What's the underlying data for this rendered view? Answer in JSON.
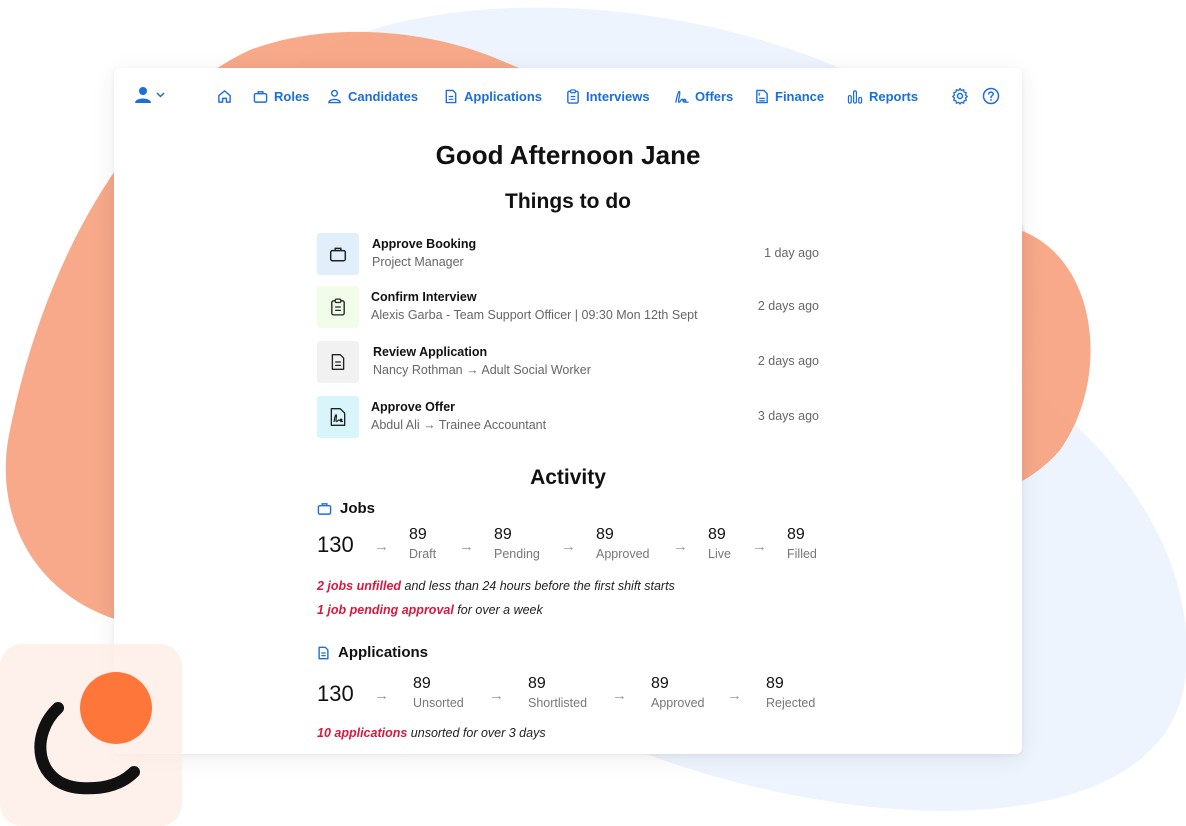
{
  "colors": {
    "accent": "#1a6ede",
    "alert": "#d7193f",
    "blob_orange": "#f6a07c",
    "blob_blue": "#eef4fd",
    "logo_orange": "#ff763b"
  },
  "nav": {
    "user_icon": "user-icon",
    "items": [
      {
        "label": "",
        "icon": "home-icon"
      },
      {
        "label": "Roles",
        "icon": "briefcase-icon"
      },
      {
        "label": "Candidates",
        "icon": "person-icon"
      },
      {
        "label": "Applications",
        "icon": "document-icon"
      },
      {
        "label": "Interviews",
        "icon": "clipboard-icon"
      },
      {
        "label": "Offers",
        "icon": "signature-icon"
      },
      {
        "label": "Finance",
        "icon": "invoice-icon"
      },
      {
        "label": "Reports",
        "icon": "bar-chart-icon"
      }
    ],
    "settings_icon": "gear-icon",
    "help_icon": "help-icon"
  },
  "greeting": "Good Afternoon Jane",
  "todo": {
    "heading": "Things to do",
    "items": [
      {
        "title": "Approve Booking",
        "subtitle": "Project Manager",
        "time": "1 day ago",
        "icon": "briefcase-icon",
        "bg": "#e1effd"
      },
      {
        "title": "Confirm Interview",
        "subtitle": "Alexis Garba - Team Support Officer | 09:30 Mon 12th Sept",
        "time": "2 days ago",
        "icon": "clipboard-icon",
        "bg": "#f1fde9"
      },
      {
        "title": "Review Application",
        "subtitle": "Nancy Rothman → Adult Social Worker",
        "time": "2 days ago",
        "icon": "document-icon",
        "bg": "#f1f1f1"
      },
      {
        "title": "Approve Offer",
        "subtitle": "Abdul Ali → Trainee Accountant",
        "time": "3 days ago",
        "icon": "signature-icon",
        "bg": "#d9f5fc"
      }
    ]
  },
  "activity": {
    "heading": "Activity",
    "jobs": {
      "title": "Jobs",
      "total": "130",
      "stages": [
        {
          "value": "89",
          "label": "Draft"
        },
        {
          "value": "89",
          "label": "Pending"
        },
        {
          "value": "89",
          "label": "Approved"
        },
        {
          "value": "89",
          "label": "Live"
        },
        {
          "value": "89",
          "label": "Filled"
        }
      ],
      "alerts": [
        {
          "highlight": "2 jobs unfilled",
          "text": " and less than 24 hours before the first shift starts"
        },
        {
          "highlight": "1 job pending approval",
          "text": " for over a week"
        }
      ]
    },
    "applications": {
      "title": "Applications",
      "total": "130",
      "stages": [
        {
          "value": "89",
          "label": "Unsorted"
        },
        {
          "value": "89",
          "label": "Shortlisted"
        },
        {
          "value": "89",
          "label": "Approved"
        },
        {
          "value": "89",
          "label": "Rejected"
        }
      ],
      "alerts": [
        {
          "highlight": "10 applications",
          "text": " unsorted for over 3 days"
        }
      ]
    },
    "arrow": "→"
  }
}
